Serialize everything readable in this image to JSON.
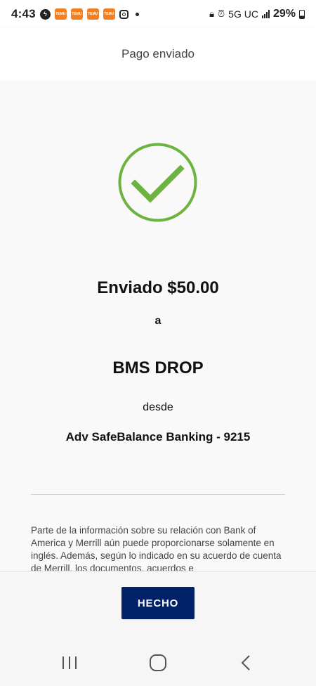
{
  "status_bar": {
    "time": "4:43",
    "notification_icons": [
      "messenger-icon",
      "temu-icon",
      "temu-icon",
      "temu-icon",
      "temu-icon",
      "instagram-icon",
      "dot-icon"
    ],
    "temu_label": "TEMU",
    "network": "5G UC",
    "battery_percent": "29%"
  },
  "header": {
    "title": "Pago enviado"
  },
  "confirmation": {
    "amount_line": "Enviado $50.00",
    "to_label": "a",
    "recipient": "BMS DROP",
    "from_label": "desde",
    "account": "Adv SafeBalance Banking - 9215",
    "success_color": "#6db33f"
  },
  "disclaimer": {
    "text": "Parte de la información sobre su relación con Bank of America y Merrill aún puede proporcionarse solamente en inglés. Además, según lo indicado en su acuerdo de cuenta de Merrill, los documentos, acuerdos e"
  },
  "actions": {
    "done_label": "HECHO",
    "button_color": "#012169"
  },
  "nav_bar": {
    "buttons": [
      "recent-apps-icon",
      "home-icon",
      "back-icon"
    ]
  }
}
